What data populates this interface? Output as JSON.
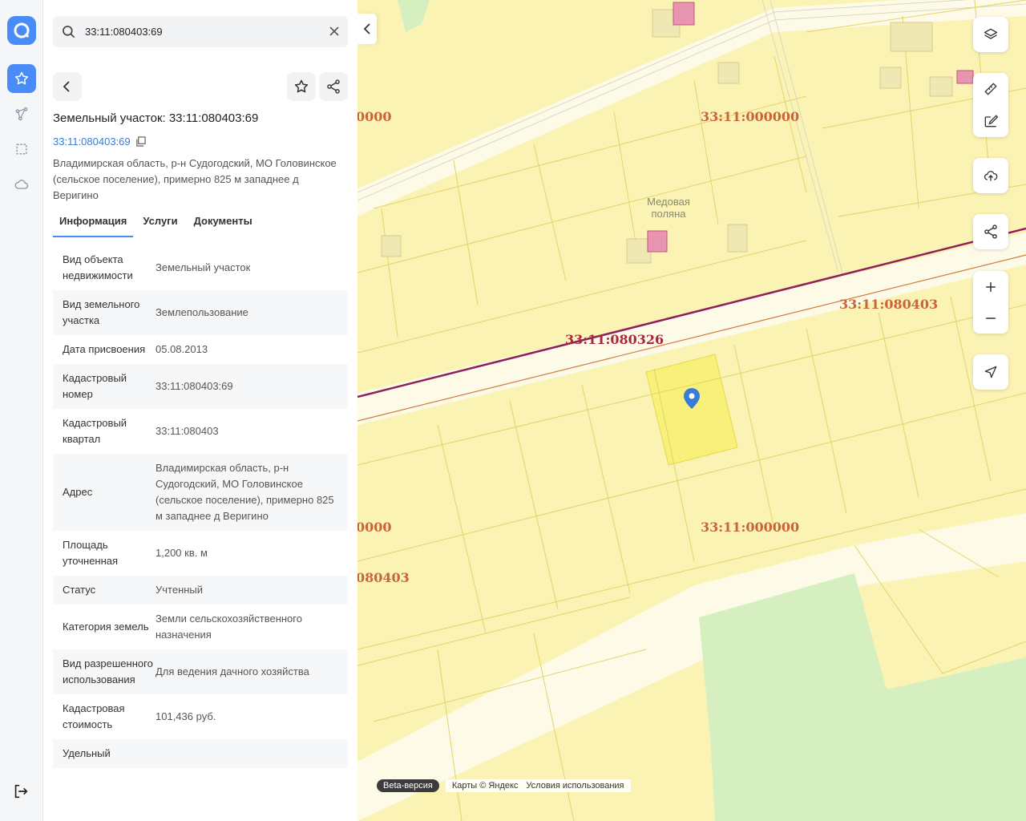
{
  "search": {
    "value": "33:11:080403:69"
  },
  "object": {
    "title": "Земельный участок: 33:11:080403:69",
    "cad_number_link": "33:11:080403:69",
    "address": "Владимирская область, р-н Судогодский, МО Головинское (сельское поселение), примерно 825 м западнее д Веригино"
  },
  "tabs": [
    "Информация",
    "Услуги",
    "Документы"
  ],
  "info": [
    {
      "k": "Вид объекта недвижимости",
      "v": "Земельный участок"
    },
    {
      "k": "Вид земельного участка",
      "v": "Землепользование"
    },
    {
      "k": "Дата присвоения",
      "v": "05.08.2013"
    },
    {
      "k": "Кадастровый номер",
      "v": "33:11:080403:69"
    },
    {
      "k": "Кадастровый квартал",
      "v": "33:11:080403"
    },
    {
      "k": "Адрес",
      "v": "Владимирская область, р-н Судогодский, МО Головинское (сельское поселение), примерно 825 м западнее д Веригино"
    },
    {
      "k": "Площадь уточненная",
      "v": "1,200 кв. м"
    },
    {
      "k": "Статус",
      "v": "Учтенный"
    },
    {
      "k": "Категория земель",
      "v": "Земли сельскохозяйственного назначения"
    },
    {
      "k": "Вид разрешенного использования",
      "v": "Для ведения дачного хозяйства"
    },
    {
      "k": "Кадастровая стоимость",
      "v": "101,436 руб."
    },
    {
      "k": "Удельный",
      "v": ""
    }
  ],
  "map": {
    "labels": {
      "l1": "0000",
      "l2": "33:11:000000",
      "l3": "33:11:080403",
      "l4": "33:11:080326",
      "l5": "0000",
      "l6": "33:11:000000",
      "l7": "080403"
    },
    "poi": "Медовая поляна",
    "beta": "Beta-версия",
    "attribution": "Карты © Яндекс",
    "terms": "Условия использования"
  },
  "colors": {
    "accent": "#4a8cf7",
    "parcel_fill": "#fbf3b4",
    "selected_fill": "#f7f07a"
  }
}
